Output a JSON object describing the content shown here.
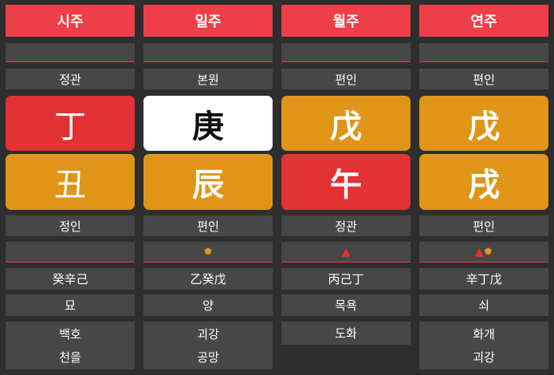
{
  "pillars": [
    {
      "header": "시주",
      "stem_god": "정관",
      "stem": "丁",
      "branch": "丑",
      "branch_god": "정인",
      "hidden_stems": "癸辛己",
      "stage": "묘",
      "spirits": [
        "백호",
        "천을"
      ],
      "stem_color": "#e23233",
      "branch_color": "#e09518"
    },
    {
      "header": "일주",
      "stem_god": "본원",
      "stem": "庚",
      "branch": "辰",
      "branch_god": "편인",
      "marks": "✹",
      "hidden_stems": "乙癸戊",
      "stage": "양",
      "spirits": [
        "괴강",
        "공망"
      ],
      "stem_color": "#ffffff",
      "branch_color": "#e09518"
    },
    {
      "header": "월주",
      "stem_god": "편인",
      "stem": "戊",
      "branch": "午",
      "branch_god": "정관",
      "marks": "▲",
      "hidden_stems": "丙己丁",
      "stage": "목욕",
      "spirits": [
        "도화"
      ],
      "stem_color": "#e09518",
      "branch_color": "#e23233"
    },
    {
      "header": "연주",
      "stem_god": "편인",
      "stem": "戊",
      "branch": "戌",
      "branch_god": "편인",
      "marks_tri": "▲",
      "marks_sun": "✹",
      "hidden_stems": "辛丁戊",
      "stage": "쇠",
      "spirits": [
        "화개",
        "괴강"
      ],
      "stem_color": "#e09518",
      "branch_color": "#e09518"
    }
  ]
}
